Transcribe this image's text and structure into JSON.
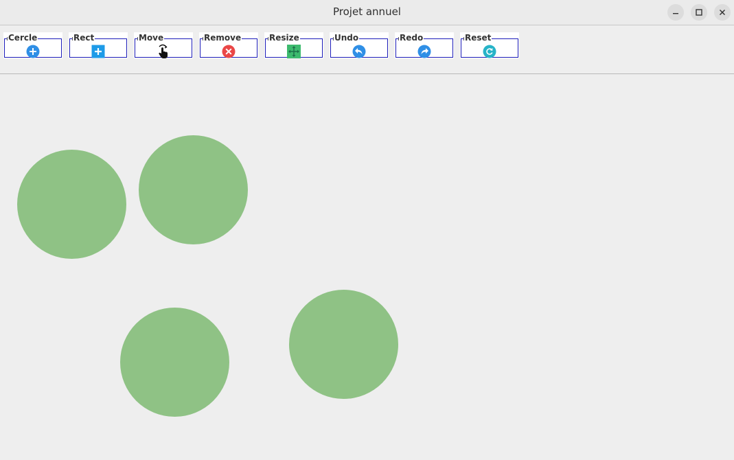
{
  "window": {
    "title": "Projet annuel",
    "controls": [
      "minimize-icon",
      "maximize-icon",
      "close-icon"
    ]
  },
  "toolbar": {
    "tools": [
      {
        "label": "Cercle",
        "icon": "add-circle-icon",
        "color": "#2f8fe6"
      },
      {
        "label": "Rect",
        "icon": "add-square-icon",
        "color": "#1e9be8"
      },
      {
        "label": "Move",
        "icon": "hand-pointer-icon",
        "color": "#000000"
      },
      {
        "label": "Remove",
        "icon": "remove-icon",
        "color": "#ea4747"
      },
      {
        "label": "Resize",
        "icon": "resize-arrows-icon",
        "color": "#3dba6e"
      },
      {
        "label": "Undo",
        "icon": "undo-icon",
        "color": "#2f8fe6"
      },
      {
        "label": "Redo",
        "icon": "redo-icon",
        "color": "#2f8fe6"
      },
      {
        "label": "Reset",
        "icon": "reset-icon",
        "color": "#27b4c8"
      }
    ]
  },
  "canvas": {
    "shape_color": "#8fc285",
    "shape_count": 4
  }
}
